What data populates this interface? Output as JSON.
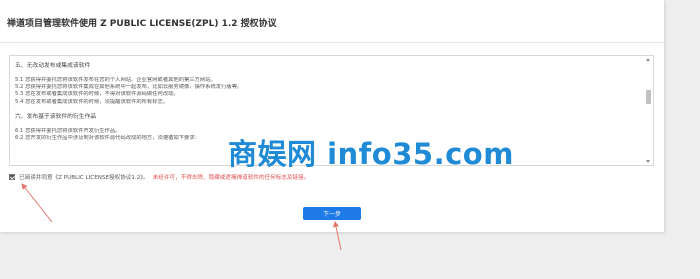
{
  "page": {
    "title": "禅道项目管理软件使用 Z PUBLIC LICENSE(ZPL) 1.2 授权协议"
  },
  "license": {
    "section5_title": "五、无改动发布或集成该软件",
    "section5_lines": [
      "5.1 您获得并委托您将该软件发布在您的个人网站、企业官网或者其他的第三方网站。",
      "5.2 您获得并委托您将该软件集成在其他系统中一起发布，比如云服务镜像、操作系统发行版等。",
      "5.3 您在发布或者集成该软件的时候，不得对该软件源码做任何改动。",
      "5.4 您在发布或者集成该软件的时候，须提醒该软件的所有标志。"
    ],
    "section6_title": "六、发布基于该软件的衍生作品",
    "section6_lines": [
      "6.1 您获得并委托您将该软件开发衍生作品。",
      "6.2 您开发的衍生作品中涉及到对该软件源代码改动的地方，须遵循如下要求："
    ]
  },
  "agreement": {
    "label": "已阅读并同意《Z PUBLIC LICENSE授权协议1.2》。",
    "warning": "未经许可，不得去除、隐藏或遮掩禅道软件的任何标志及链接。",
    "checked": true
  },
  "next_button": {
    "label": "下一步"
  },
  "watermark": {
    "text": "商娱网 info35.com"
  },
  "colors": {
    "accent": "#1e7ae6",
    "warning": "#e05050",
    "annotation_arrow": "#e8756a",
    "watermark": "#1f8bd6"
  }
}
